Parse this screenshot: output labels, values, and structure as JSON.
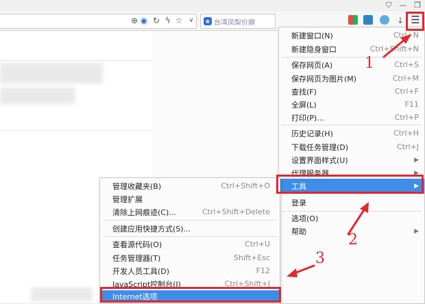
{
  "toolbar": {
    "search_text": "台湾凤梨价崩"
  },
  "main_menu": {
    "items": [
      {
        "label": "新建窗口(N)",
        "shortcut": "Ctrl+N"
      },
      {
        "label": "新建隐身窗口",
        "shortcut": "Ctrl+Shift+N"
      },
      {
        "label": "保存网页(A)",
        "shortcut": "Ctrl+S"
      },
      {
        "label": "保存网页为图片(M)",
        "shortcut": "Ctrl+M"
      },
      {
        "label": "查找(F)",
        "shortcut": "Ctrl+F"
      },
      {
        "label": "全屏(L)",
        "shortcut": "F11"
      },
      {
        "label": "打印(P)...",
        "shortcut": "Ctrl+P"
      },
      {
        "label": "历史记录(H)",
        "shortcut": "Ctrl+H"
      },
      {
        "label": "下载任务管理(D)",
        "shortcut": "Ctrl+J"
      },
      {
        "label": "设置界面样式(U)",
        "shortcut": ""
      },
      {
        "label": "代理服务器",
        "shortcut": ""
      },
      {
        "label": "工具",
        "shortcut": ""
      },
      {
        "label": "登录",
        "shortcut": ""
      },
      {
        "label": "选项(O)",
        "shortcut": ""
      },
      {
        "label": "帮助",
        "shortcut": ""
      }
    ]
  },
  "sub_menu": {
    "items": [
      {
        "label": "管理收藏夹(B)",
        "shortcut": "Ctrl+Shift+O"
      },
      {
        "label": "管理扩展",
        "shortcut": ""
      },
      {
        "label": "清除上网痕迹(C)...",
        "shortcut": "Ctrl+Shift+Delete"
      },
      {
        "label": "创建应用快捷方式(S)...",
        "shortcut": ""
      },
      {
        "label": "查看源代码(O)",
        "shortcut": "Ctrl+U"
      },
      {
        "label": "任务管理器(T)",
        "shortcut": "Shift+Esc"
      },
      {
        "label": "开发人员工具(D)",
        "shortcut": "F12"
      },
      {
        "label": "JavaScript控制台(J)",
        "shortcut": "Ctrl+Shift+J"
      },
      {
        "label": "Internet选项",
        "shortcut": ""
      }
    ]
  },
  "annotations": {
    "step1": "1",
    "step2": "2",
    "step3": "3",
    "color": "#e0282d"
  },
  "colors": {
    "highlight": "#3d8ee8"
  },
  "icons": {
    "menu": "hamburger-menu-icon",
    "window_restore": "window-restore-icon",
    "window_min": "window-minimize-icon",
    "zoom": "zoom-icon",
    "refresh": "refresh-icon",
    "lightning": "lightning-icon",
    "favorite": "star-icon",
    "dropdown": "chevron-down-icon",
    "download": "download-arrow-icon",
    "search_engine": "paw-icon"
  }
}
